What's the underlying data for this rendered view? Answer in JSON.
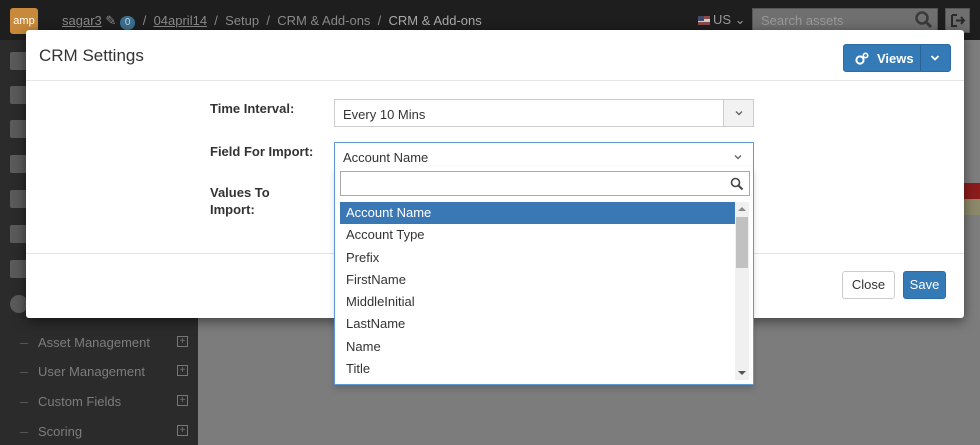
{
  "topbar": {
    "logo_text": "amp",
    "breadcrumb": {
      "user": "sagar3",
      "badge": "0",
      "sep": "/",
      "account": "04april14",
      "setup": "Setup",
      "crm": "CRM & Add-ons",
      "current": "CRM & Add-ons"
    },
    "locale": "US",
    "search_placeholder": "Search assets"
  },
  "sidebar": {
    "items": [
      {
        "label": "Asset Management"
      },
      {
        "label": "User Management"
      },
      {
        "label": "Custom Fields"
      },
      {
        "label": "Scoring"
      }
    ]
  },
  "modal": {
    "title": "CRM Settings",
    "views_label": "Views",
    "time_interval_label": "Time Interval:",
    "time_interval_value": "Every 10 Mins",
    "field_for_import_label": "Field For Import:",
    "field_for_import_value": "Account Name",
    "values_to_import_label_1": "Values To",
    "values_to_import_label_2": "Import:",
    "close_label": "Close",
    "save_label": "Save"
  },
  "dropdown": {
    "search_value": "",
    "options": [
      "Account Name",
      "Account Type",
      "Prefix",
      "FirstName",
      "MiddleInitial",
      "LastName",
      "Name",
      "Title"
    ],
    "selected": "Account Name"
  },
  "colors": {
    "primary": "#337ab7",
    "selected_option": "#3a77b5",
    "backdrop": "#7a7a7a"
  }
}
